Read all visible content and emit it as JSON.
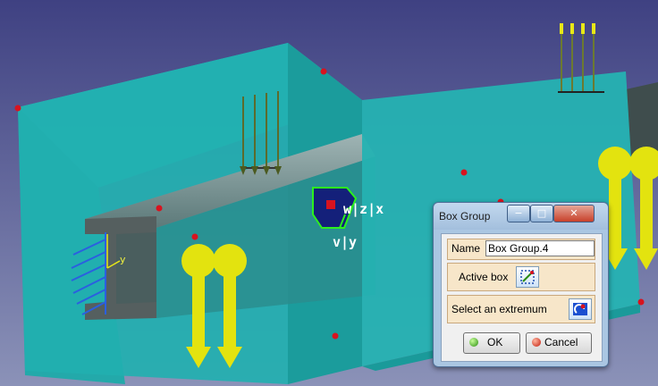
{
  "scene": {
    "background_color": "#4a4f86",
    "box_color": "#1fb3b3",
    "beam_color": "#4a5d5d",
    "load_arrow_color": "#e8e817",
    "marker_color": "#d8131f",
    "axis_labels": {
      "wzx": "w|z|x",
      "vy": "v|y"
    },
    "clamp_axis_label": "y"
  },
  "dialog": {
    "title": "Box Group",
    "window_buttons": {
      "minimize": "−",
      "maximize": "□",
      "close": "✕"
    },
    "name_label": "Name",
    "name_value": "Box Group.4",
    "active_box_label": "Active box",
    "active_box_icon": "box-select-icon",
    "extremum_label": "Select an extremum",
    "extremum_icon": "extremum-select-icon",
    "ok_label": "OK",
    "cancel_label": "Cancel"
  }
}
